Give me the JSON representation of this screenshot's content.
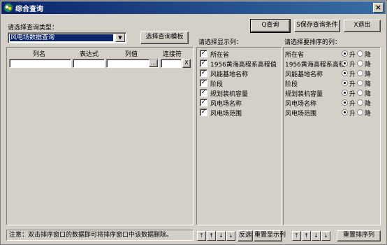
{
  "window": {
    "title": "综合查询",
    "close_glyph": "×"
  },
  "query_type": {
    "label": "请选择查询类型：",
    "selected": "风电场数据查询",
    "template_button": "选择查询模板"
  },
  "toolbar": {
    "query": "Q查询",
    "save": "S保存查询条件",
    "exit": "X退出"
  },
  "conditions": {
    "headers": [
      "列名",
      "表达式",
      "列值",
      "连接符"
    ],
    "ellipsis": "...",
    "remove": "X"
  },
  "display": {
    "label": "请选择显示列：",
    "items": [
      "所在省",
      "1956黄海高程系高程值",
      "风能基地名称",
      "阶段",
      "规划装机容量",
      "风电场名称",
      "风电场范围"
    ],
    "check_mark": "✓"
  },
  "sort": {
    "label": "请选择要排序的列：",
    "items": [
      "所在省",
      "1956黄海高程系高程",
      "风能基地名称",
      "阶段",
      "规划装机容量",
      "风电场名称",
      "风电场范围"
    ],
    "asc": "升",
    "desc": "降"
  },
  "bottom": {
    "note": "注意：双击排序窗口的数据即可将排序窗口中该数据删除。",
    "invert": "反选",
    "reset_display": "重置显示列",
    "reset_sort": "重置排序列",
    "move_glyphs": [
      "⤒",
      "↑",
      "↓",
      "⤓"
    ]
  }
}
